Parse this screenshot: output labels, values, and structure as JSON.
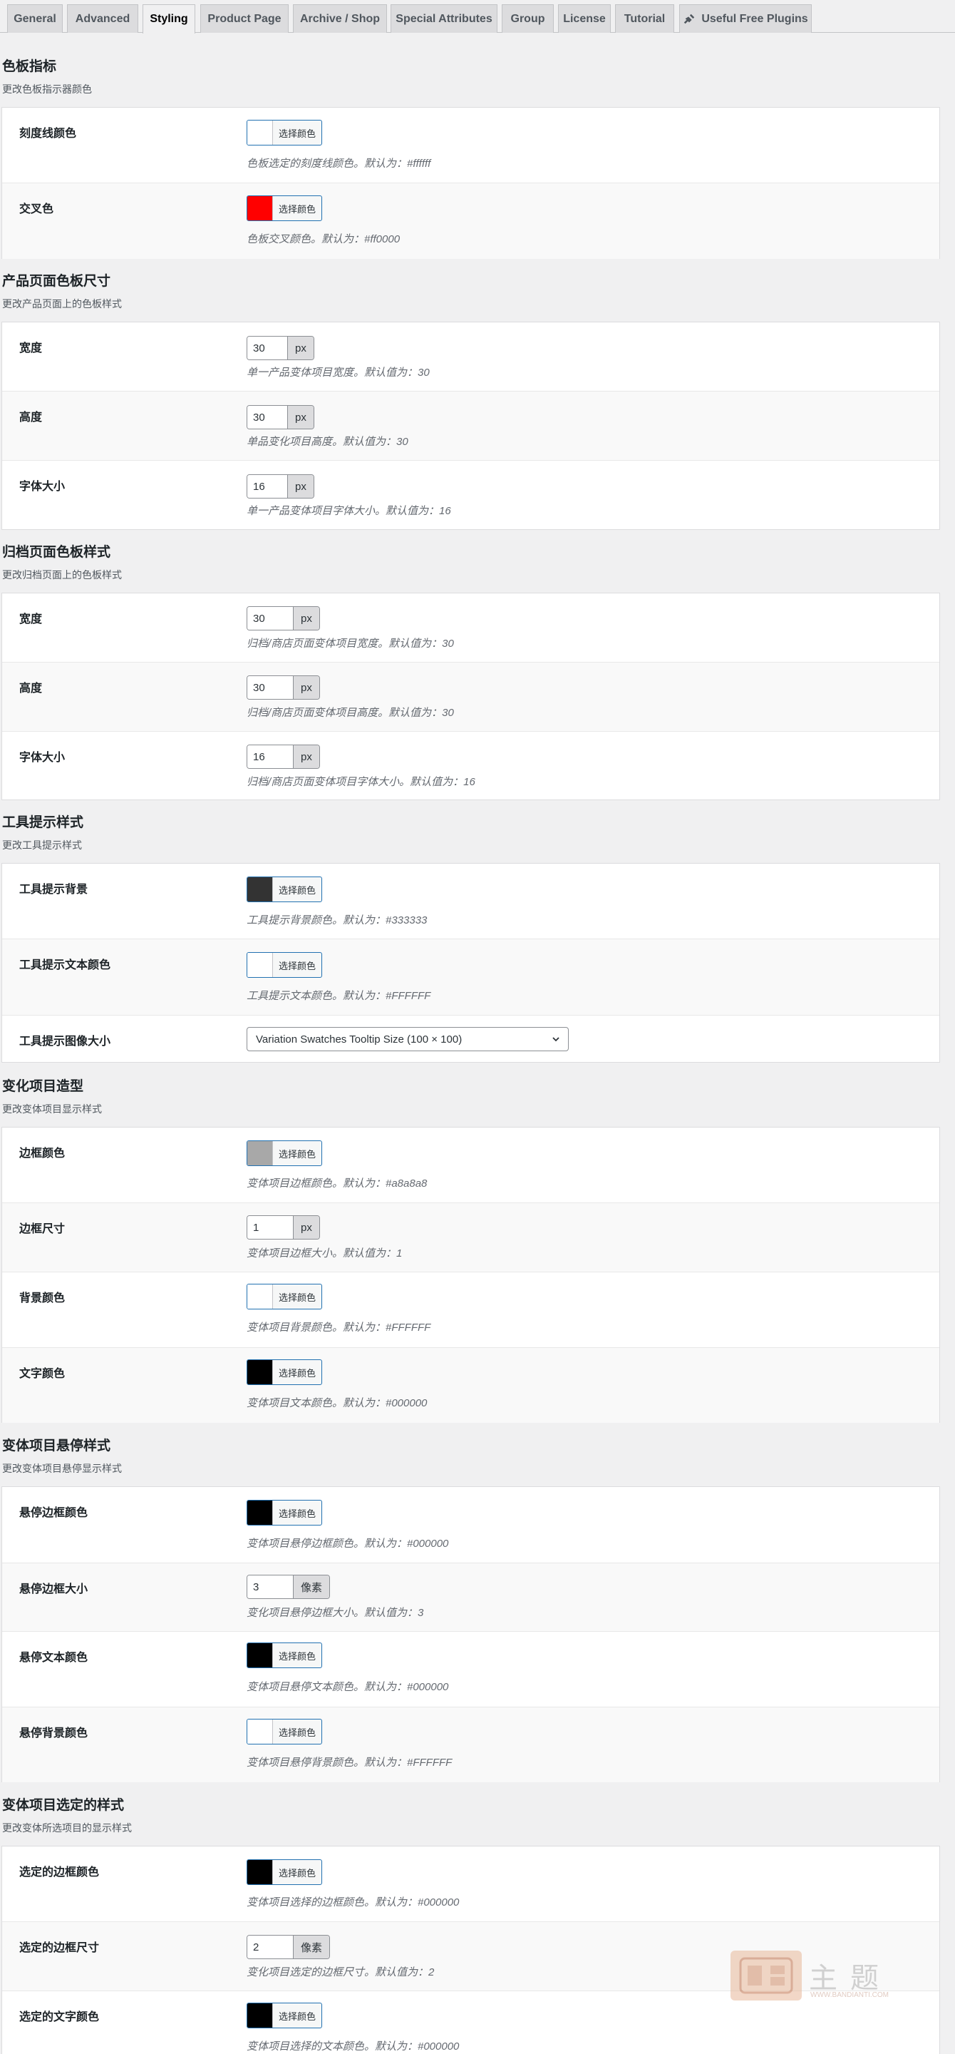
{
  "tabs": [
    {
      "label": "General"
    },
    {
      "label": "Advanced"
    },
    {
      "label": "Styling"
    },
    {
      "label": "Product Page"
    },
    {
      "label": "Archive / Shop"
    },
    {
      "label": "Special Attributes"
    },
    {
      "label": "Group"
    },
    {
      "label": "License"
    },
    {
      "label": "Tutorial"
    },
    {
      "label": "Useful Free Plugins",
      "icon": "plug-icon"
    }
  ],
  "active_tab": "Styling",
  "color_button_text": "选择颜色",
  "unit_px": "px",
  "unit_pixel": "像素",
  "sections": {
    "swatch_indicator": {
      "title": "色板指标",
      "desc": "更改色板指示器颜色",
      "tick_color": {
        "label": "刻度线颜色",
        "color": "#ffffff",
        "desc": "色板选定的刻度线颜色。默认为：#ffffff"
      },
      "cross_color": {
        "label": "交叉色",
        "color": "#ff0000",
        "desc": "色板交叉颜色。默认为：#ff0000"
      }
    },
    "product_size": {
      "title": "产品页面色板尺寸",
      "desc": "更改产品页面上的色板样式",
      "width": {
        "label": "宽度",
        "value": "30",
        "desc": "单一产品变体项目宽度。默认值为：30"
      },
      "height": {
        "label": "高度",
        "value": "30",
        "desc": "单品变化项目高度。默认值为：30"
      },
      "font_size": {
        "label": "字体大小",
        "value": "16",
        "desc": "单一产品变体项目字体大小。默认值为：16"
      }
    },
    "archive_size": {
      "title": "归档页面色板样式",
      "desc": "更改归档页面上的色板样式",
      "width": {
        "label": "宽度",
        "value": "30",
        "desc": "归档/商店页面变体项目宽度。默认值为：30"
      },
      "height": {
        "label": "高度",
        "value": "30",
        "desc": "归档/商店页面变体项目高度。默认值为：30"
      },
      "font_size": {
        "label": "字体大小",
        "value": "16",
        "desc": "归档/商店页面变体项目字体大小。默认值为：16"
      }
    },
    "tooltip": {
      "title": "工具提示样式",
      "desc": "更改工具提示样式",
      "bg": {
        "label": "工具提示背景",
        "color": "#333333",
        "desc": "工具提示背景颜色。默认为：#333333"
      },
      "text": {
        "label": "工具提示文本颜色",
        "color": "#ffffff",
        "desc": "工具提示文本颜色。默认为：#FFFFFF"
      },
      "image_size": {
        "label": "工具提示图像大小",
        "value": "Variation Swatches Tooltip Size (100 × 100)"
      }
    },
    "item_style": {
      "title": "变化项目造型",
      "desc": "更改变体项目显示样式",
      "border_color": {
        "label": "边框颜色",
        "color": "#a8a8a8",
        "desc": "变体项目边框颜色。默认为：#a8a8a8"
      },
      "border_size": {
        "label": "边框尺寸",
        "value": "1",
        "desc": "变体项目边框大小。默认值为：1"
      },
      "bg_color": {
        "label": "背景颜色",
        "color": "#ffffff",
        "desc": "变体项目背景颜色。默认为：#FFFFFF"
      },
      "text_color": {
        "label": "文字颜色",
        "color": "#000000",
        "desc": "变体项目文本颜色。默认为：#000000"
      }
    },
    "hover_style": {
      "title": "变体项目悬停样式",
      "desc": "更改变体项目悬停显示样式",
      "border_color": {
        "label": "悬停边框颜色",
        "color": "#000000",
        "desc": "变体项目悬停边框颜色。默认为：#000000"
      },
      "border_size": {
        "label": "悬停边框大小",
        "value": "3",
        "desc": "变化项目悬停边框大小。默认值为：3"
      },
      "text_color": {
        "label": "悬停文本颜色",
        "color": "#000000",
        "desc": "变体项目悬停文本颜色。默认为：#000000"
      },
      "bg_color": {
        "label": "悬停背景颜色",
        "color": "#ffffff",
        "desc": "变体项目悬停背景颜色。默认为：#FFFFFF"
      }
    },
    "selected_style": {
      "title": "变体项目选定的样式",
      "desc": "更改变体所选项目的显示样式",
      "border_color": {
        "label": "选定的边框颜色",
        "color": "#000000",
        "desc": "变体项目选择的边框颜色。默认为：#000000"
      },
      "border_size": {
        "label": "选定的边框尺寸",
        "value": "2",
        "desc": "变化项目选定的边框尺寸。默认值为：2"
      },
      "text_color": {
        "label": "选定的文字颜色",
        "color": "#000000",
        "desc": "变体项目选择的文本颜色。默认为：#000000"
      }
    }
  },
  "watermark": {
    "text": "主题",
    "sub": "WWW.BANDIANTI.COM"
  }
}
